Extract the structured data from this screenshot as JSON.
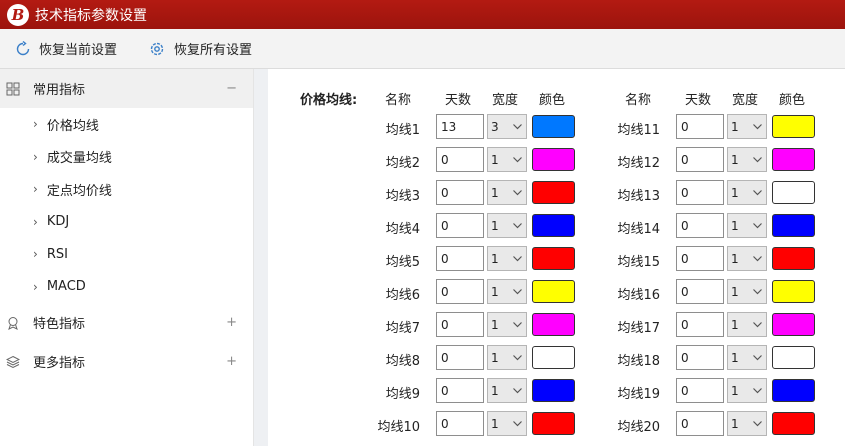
{
  "window": {
    "title": "技术指标参数设置",
    "logo_letter": "B"
  },
  "toolbar": {
    "restore_current": "恢复当前设置",
    "restore_all": "恢复所有设置"
  },
  "sidebar": {
    "groups": [
      {
        "label": "常用指标",
        "sign": "−",
        "expanded": true,
        "items": [
          {
            "label": "价格均线"
          },
          {
            "label": "成交量均线"
          },
          {
            "label": "定点均价线"
          },
          {
            "label": "KDJ"
          },
          {
            "label": "RSI"
          },
          {
            "label": "MACD"
          }
        ]
      },
      {
        "label": "特色指标",
        "sign": "+"
      },
      {
        "label": "更多指标",
        "sign": "+"
      }
    ]
  },
  "main": {
    "section_title": "价格均线:",
    "headers": {
      "name": "名称",
      "days": "天数",
      "width": "宽度",
      "color": "颜色"
    },
    "rows": [
      {
        "label": "均线1",
        "days": "13",
        "width": "3",
        "color": "#0078ff"
      },
      {
        "label": "均线2",
        "days": "0",
        "width": "1",
        "color": "#ff00ff"
      },
      {
        "label": "均线3",
        "days": "0",
        "width": "1",
        "color": "#ff0000"
      },
      {
        "label": "均线4",
        "days": "0",
        "width": "1",
        "color": "#0000ff"
      },
      {
        "label": "均线5",
        "days": "0",
        "width": "1",
        "color": "#ff0000"
      },
      {
        "label": "均线6",
        "days": "0",
        "width": "1",
        "color": "#ffff00"
      },
      {
        "label": "均线7",
        "days": "0",
        "width": "1",
        "color": "#ff00ff"
      },
      {
        "label": "均线8",
        "days": "0",
        "width": "1",
        "color": "#ffffff"
      },
      {
        "label": "均线9",
        "days": "0",
        "width": "1",
        "color": "#0000ff"
      },
      {
        "label": "均线10",
        "days": "0",
        "width": "1",
        "color": "#ff0000"
      },
      {
        "label": "均线11",
        "days": "0",
        "width": "1",
        "color": "#ffff00"
      },
      {
        "label": "均线12",
        "days": "0",
        "width": "1",
        "color": "#ff00ff"
      },
      {
        "label": "均线13",
        "days": "0",
        "width": "1",
        "color": "#ffffff"
      },
      {
        "label": "均线14",
        "days": "0",
        "width": "1",
        "color": "#0000ff"
      },
      {
        "label": "均线15",
        "days": "0",
        "width": "1",
        "color": "#ff0000"
      },
      {
        "label": "均线16",
        "days": "0",
        "width": "1",
        "color": "#ffff00"
      },
      {
        "label": "均线17",
        "days": "0",
        "width": "1",
        "color": "#ff00ff"
      },
      {
        "label": "均线18",
        "days": "0",
        "width": "1",
        "color": "#ffffff"
      },
      {
        "label": "均线19",
        "days": "0",
        "width": "1",
        "color": "#0000ff"
      },
      {
        "label": "均线20",
        "days": "0",
        "width": "1",
        "color": "#ff0000"
      }
    ]
  }
}
